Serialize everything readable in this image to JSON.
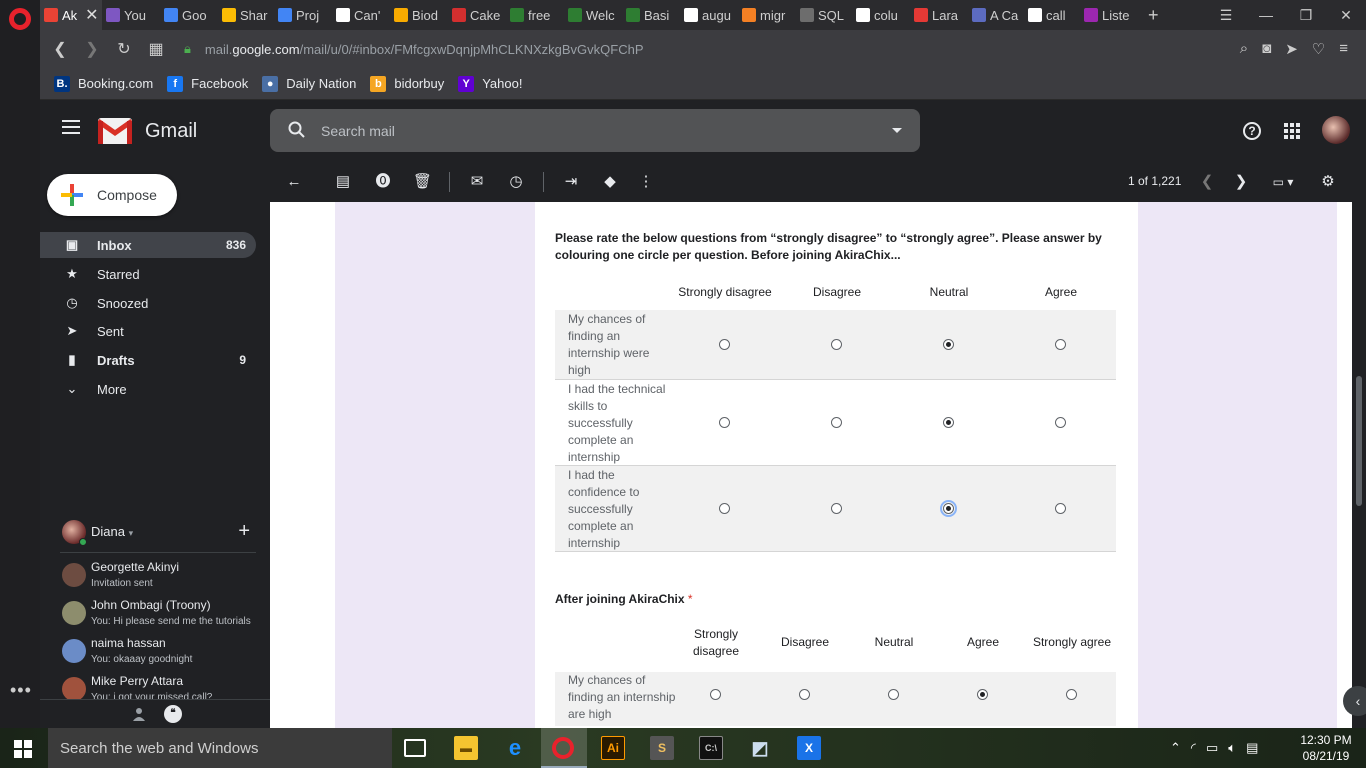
{
  "browser": {
    "tabs": [
      {
        "label": "Ak",
        "color": "#ea4335",
        "active": true
      },
      {
        "label": "You",
        "color": "#7e57c2"
      },
      {
        "label": "Goo",
        "color": "#4285f4"
      },
      {
        "label": "Shar",
        "color": "#fbbc04"
      },
      {
        "label": "Proj",
        "color": "#4285f4"
      },
      {
        "label": "Can'",
        "color": "#ffffff"
      },
      {
        "label": "Biod",
        "color": "#f9ab00"
      },
      {
        "label": "Cake",
        "color": "#d32f2f"
      },
      {
        "label": "free",
        "color": "#2e7d32"
      },
      {
        "label": "Welc",
        "color": "#2e7d32"
      },
      {
        "label": "Basi",
        "color": "#2e7d32"
      },
      {
        "label": "augu",
        "color": "#ffffff"
      },
      {
        "label": "migr",
        "color": "#f48024"
      },
      {
        "label": "SQL",
        "color": "#6d6d6d"
      },
      {
        "label": "colu",
        "color": "#ffffff"
      },
      {
        "label": "Lara",
        "color": "#e53935"
      },
      {
        "label": "A Ca",
        "color": "#5c6bc0"
      },
      {
        "label": "call",
        "color": "#ffffff"
      },
      {
        "label": "Liste",
        "color": "#9c27b0"
      }
    ],
    "url_prefix": "mail.",
    "url_domain": "google.com",
    "url_path": "/mail/u/0/#inbox/FMfcgxwDqnjpMhCLKNXzkgBvGvkQFChP",
    "bookmarks": [
      {
        "label": "Booking.com",
        "icon": "B.",
        "color": "#003580"
      },
      {
        "label": "Facebook",
        "icon": "f",
        "color": "#1877f2"
      },
      {
        "label": "Daily Nation",
        "icon": "●",
        "color": "#4a6fa5"
      },
      {
        "label": "bidorbuy",
        "icon": "b",
        "color": "#f5a623"
      },
      {
        "label": "Yahoo!",
        "icon": "Y",
        "color": "#6001d2"
      }
    ]
  },
  "gmail": {
    "product": "Gmail",
    "search_placeholder": "Search mail",
    "compose_label": "Compose",
    "nav": [
      {
        "label": "Inbox",
        "count": "836",
        "icon": "inbox-icon",
        "glyph": "▣",
        "active": true
      },
      {
        "label": "Starred",
        "count": "",
        "icon": "star-icon",
        "glyph": "★"
      },
      {
        "label": "Snoozed",
        "count": "",
        "icon": "clock-icon",
        "glyph": "◷"
      },
      {
        "label": "Sent",
        "count": "",
        "icon": "send-icon",
        "glyph": "➤"
      },
      {
        "label": "Drafts",
        "count": "9",
        "icon": "draft-icon",
        "glyph": "▮",
        "bold": true
      },
      {
        "label": "More",
        "count": "",
        "icon": "chevron-down-icon",
        "glyph": "⌄"
      }
    ],
    "hangouts": {
      "user": "Diana",
      "contacts": [
        {
          "name": "Georgette Akinyi",
          "message": "Invitation sent",
          "color": "#6d4c41"
        },
        {
          "name": "John Ombagi (Troony)",
          "message": "You: Hi please send me the tutorials",
          "color": "#8d8d6d"
        },
        {
          "name": "naima hassan",
          "message": "You: okaaay goodnight",
          "color": "#6b8cc7"
        },
        {
          "name": "Mike Perry Attara",
          "message": "You: i got your missed call?",
          "color": "#a0523d"
        }
      ]
    },
    "pager": "1 of 1,221"
  },
  "form": {
    "q1_title": "Please rate the below questions from “strongly disagree” to “strongly agree”. Please answer by colouring one circle per question. Before joining AkiraChix...",
    "q1_columns": [
      "Strongly disagree",
      "Disagree",
      "Neutral",
      "Agree"
    ],
    "q1_rows": [
      {
        "label": "My chances of finding an internship were high",
        "selected": 2
      },
      {
        "label": "I had the technical skills to successfully complete an internship",
        "selected": 2
      },
      {
        "label": "I had the confidence to successfully complete an internship",
        "selected": 2
      }
    ],
    "q2_title": "After joining AkiraChix",
    "q2_required": "*",
    "q2_columns": [
      "Strongly disagree",
      "Disagree",
      "Neutral",
      "Agree",
      "Strongly agree"
    ],
    "q2_rows": [
      {
        "label": "My chances of finding an internship are high",
        "selected": 3
      }
    ]
  },
  "taskbar": {
    "search_placeholder": "Search the web and Windows",
    "time": "12:30 PM",
    "date": "08/21/19"
  }
}
